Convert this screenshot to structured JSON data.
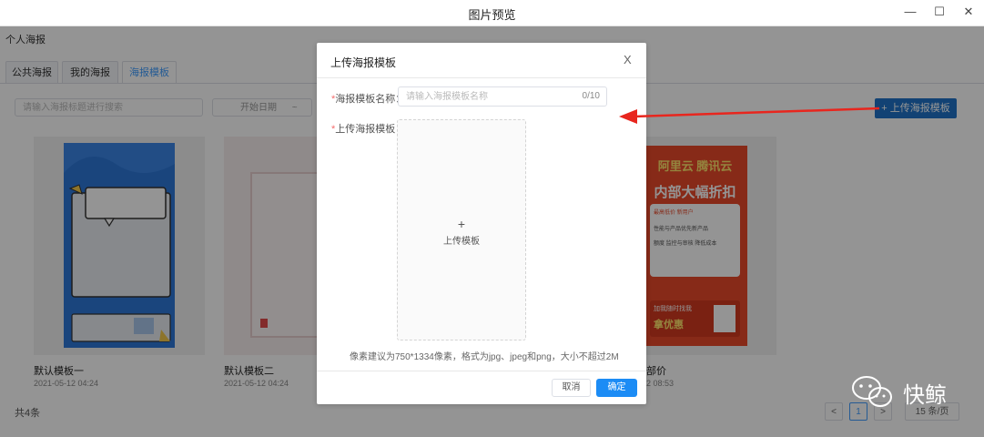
{
  "window": {
    "title": "图片预览",
    "minimize": "—",
    "maximize": "☐",
    "close": "✕"
  },
  "breadcrumb": "个人海报",
  "tabs": [
    "公共海报",
    "我的海报",
    "海报模板"
  ],
  "toolbar": {
    "search_placeholder": "请输入海报标题进行搜索",
    "date_start": "开始日期",
    "date_sep": "~",
    "upload_button": "+ 上传海报模板"
  },
  "cards": [
    {
      "name": "默认模板一",
      "date": "2021-05-12 04:24"
    },
    {
      "name": "默认模板二",
      "date": "2021-05-12 04:24"
    },
    {
      "name": "部价",
      "date": "2 08:53"
    }
  ],
  "poster3": {
    "brand": "阿里云 腾讯云",
    "line1": "内部大幅折扣",
    "tag": "最高低价 新用户",
    "item1": "性能与产品优先新产品",
    "item2": "额度 监控与审核 降低成本",
    "cta1": "加我随时找我",
    "cta2": "拿优惠"
  },
  "footer": {
    "total": "共4条",
    "page": "1",
    "prev": "<",
    "next": ">",
    "page_size": "15 条/页"
  },
  "dialog": {
    "title": "上传海报模板",
    "close": "X",
    "name_label": "海报模板名称：",
    "name_placeholder": "请输入海报模板名称",
    "name_count": "0/10",
    "upload_label": "上传海报模板：",
    "upload_plus": "+",
    "upload_text": "上传模板",
    "hint": "像素建议为750*1334像素，格式为jpg、jpeg和png，大小不超过2M",
    "cancel": "取消",
    "confirm": "确定",
    "required_mark": "*"
  },
  "watermark": "快鲸",
  "colors": {
    "primary": "#1c8cf5",
    "arrow": "#e8261e",
    "required": "#f56c6c"
  }
}
